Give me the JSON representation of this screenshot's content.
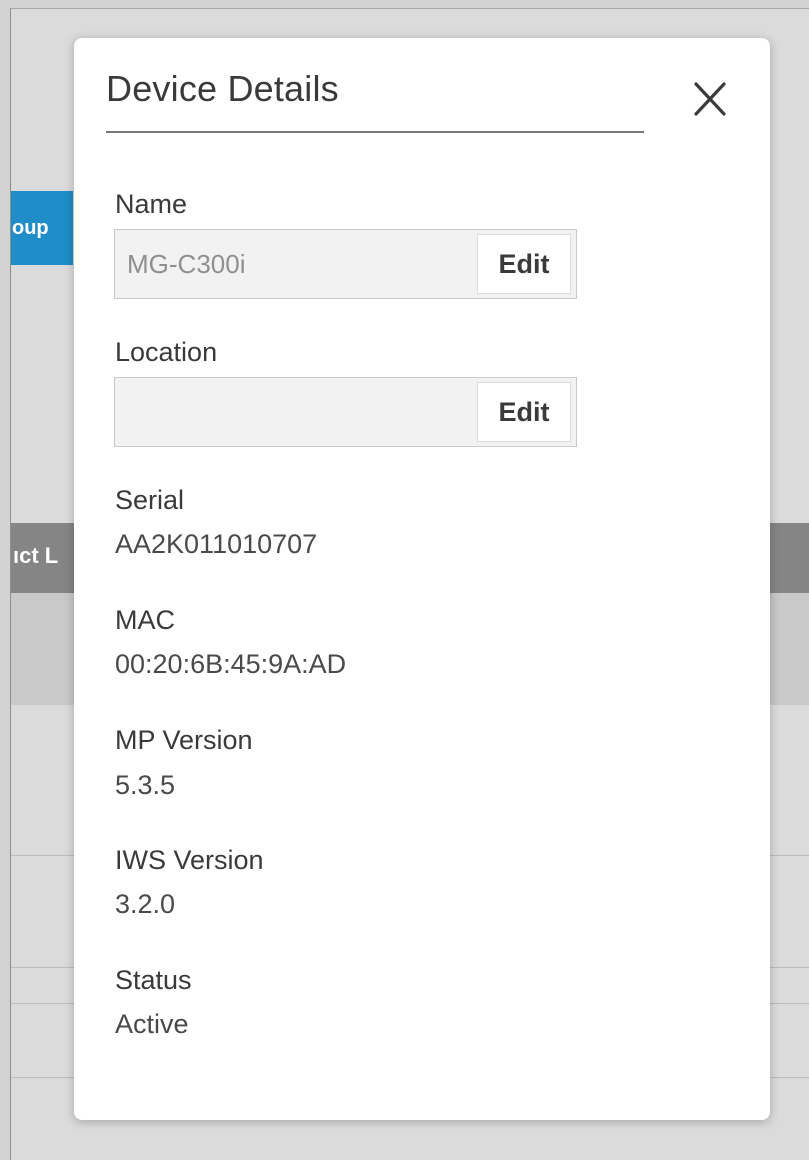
{
  "background": {
    "button_partial": "oup",
    "column_header_partial": "ıct L"
  },
  "dialog": {
    "title": "Device Details",
    "close_icon": "close-icon",
    "name": {
      "label": "Name",
      "value": "MG-C300i",
      "edit_label": "Edit"
    },
    "location": {
      "label": "Location",
      "value": "",
      "edit_label": "Edit"
    },
    "serial": {
      "label": "Serial",
      "value": "AA2K011010707"
    },
    "mac": {
      "label": "MAC",
      "value": "00:20:6B:45:9A:AD"
    },
    "mp_version": {
      "label": "MP Version",
      "value": "5.3.5"
    },
    "iws_version": {
      "label": "IWS Version",
      "value": "3.2.0"
    },
    "status": {
      "label": "Status",
      "value": "Active"
    }
  },
  "colors": {
    "accent": "#1f8dc7",
    "header_gray": "#858585",
    "dialog_bg": "#ffffff"
  }
}
